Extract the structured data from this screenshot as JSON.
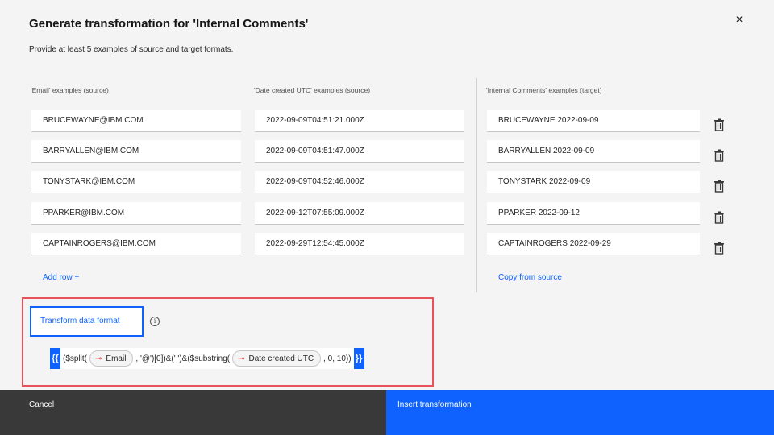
{
  "dialog": {
    "title": "Generate transformation for 'Internal Comments'",
    "subtitle": "Provide at least 5 examples of source and target formats.",
    "close_label": "×"
  },
  "columns": {
    "email_label": "'Email' examples (source)",
    "date_label": "'Date created UTC' examples (source)",
    "target_label": "'Internal Comments' examples (target)"
  },
  "rows": [
    {
      "email": "BRUCEWAYNE@IBM.COM",
      "date": "2022-09-09T04:51:21.000Z",
      "target": "BRUCEWAYNE 2022-09-09"
    },
    {
      "email": "BARRYALLEN@IBM.COM",
      "date": "2022-09-09T04:51:47.000Z",
      "target": "BARRYALLEN 2022-09-09"
    },
    {
      "email": "TONYSTARK@IBM.COM",
      "date": "2022-09-09T04:52:46.000Z",
      "target": "TONYSTARK 2022-09-09"
    },
    {
      "email": "PPARKER@IBM.COM",
      "date": "2022-09-12T07:55:09.000Z",
      "target": "PPARKER 2022-09-12"
    },
    {
      "email": "CAPTAINROGERS@IBM.COM",
      "date": "2022-09-29T12:54:45.000Z",
      "target": "CAPTAINROGERS 2022-09-29"
    }
  ],
  "actions": {
    "add_row": "Add row +",
    "copy_from_source": "Copy from source"
  },
  "transform": {
    "tab_label": "Transform data format",
    "info_icon": "i",
    "open_brace": "{{",
    "close_brace": "}}",
    "part1": "($split(",
    "pill1": "Email",
    "part2": ", '@')[0])&(' ')&($substring(",
    "pill2": "Date created UTC",
    "part3": ", 0, 10))"
  },
  "footer": {
    "cancel_label": "Cancel",
    "insert_label": "Insert transformation"
  },
  "colors": {
    "primary": "#0f62fe",
    "highlight": "#e8505b",
    "cancel_bg": "#393939"
  },
  "icons": {
    "close": "close-icon",
    "delete": "trash-icon",
    "info": "info-icon",
    "field": "field-link-icon"
  }
}
